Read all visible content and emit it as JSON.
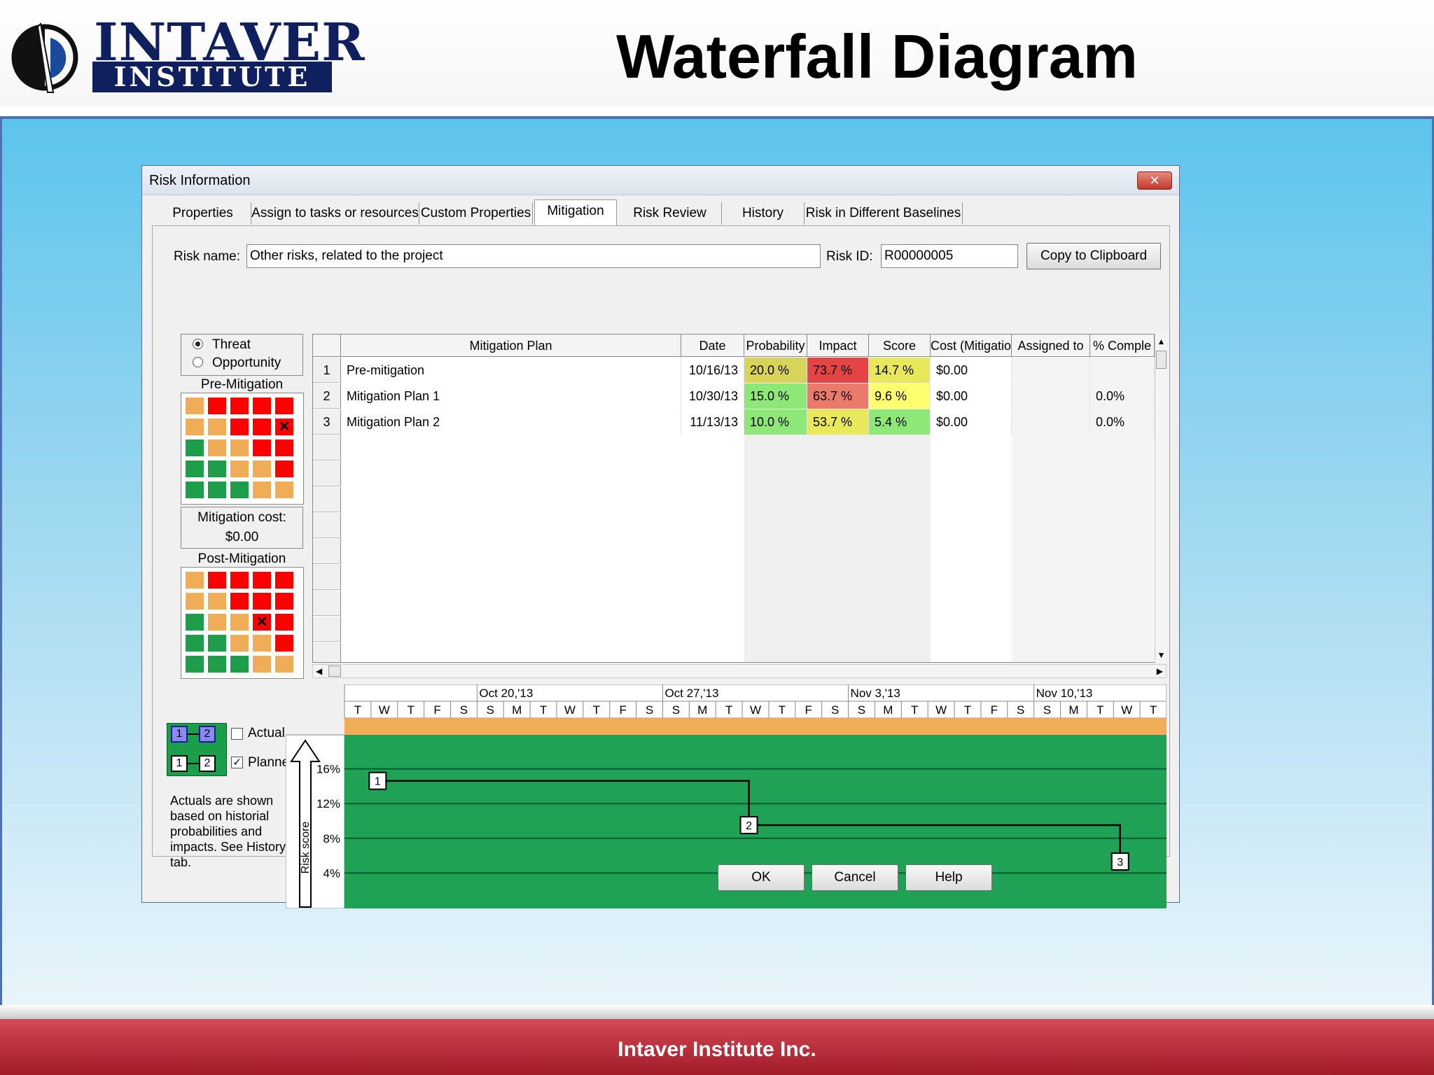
{
  "slide": {
    "logo_word1": "INTAVER",
    "logo_word2": "INSTITUTE",
    "title": "Waterfall Diagram",
    "footer": "Intaver Institute Inc."
  },
  "dialog": {
    "title": "Risk Information",
    "close_glyph": "✕",
    "tabs": [
      "Properties",
      "Assign to tasks or resources",
      "Custom Properties",
      "Mitigation",
      "Risk Review",
      "History",
      "Risk in Different Baselines"
    ],
    "active_tab": "Mitigation",
    "risk_name_label": "Risk name:",
    "risk_name_value": "Other risks, related to the project",
    "risk_id_label": "Risk ID:",
    "risk_id_value": "R00000005",
    "copy_button": "Copy to Clipboard",
    "threat_label": "Threat",
    "opportunity_label": "Opportunity",
    "pre_mitigation_label": "Pre-Mitigation",
    "post_mitigation_label": "Post-Mitigation",
    "mitigation_cost_label": "Mitigation cost:",
    "mitigation_cost_value": "$0.00",
    "ok_button": "OK",
    "cancel_button": "Cancel",
    "help_button": "Help"
  },
  "matrix": {
    "colors": {
      "orange": "#f0ac56",
      "red": "#ff0000",
      "green": "#1e9e4a"
    },
    "cells": [
      [
        "orange",
        "red",
        "red",
        "red",
        "red"
      ],
      [
        "orange",
        "orange",
        "red",
        "red",
        "red"
      ],
      [
        "green",
        "orange",
        "orange",
        "red",
        "red"
      ],
      [
        "green",
        "green",
        "orange",
        "orange",
        "red"
      ],
      [
        "green",
        "green",
        "green",
        "orange",
        "orange"
      ]
    ],
    "pre_mark": [
      1,
      4
    ],
    "post_mark": [
      2,
      3
    ],
    "mark_glyph": "✕"
  },
  "table": {
    "columns": [
      "Mitigation Plan",
      "Date",
      "Probability",
      "Impact",
      "Score",
      "Cost (Mitigatio",
      "Assigned to",
      "% Comple"
    ],
    "rows": [
      {
        "n": "1",
        "plan": "Pre-mitigation",
        "date": "10/16/13",
        "prob": "20.0 %",
        "impact": "73.7 %",
        "score": "14.7 %",
        "cost": "$0.00",
        "assigned": "",
        "pct": ""
      },
      {
        "n": "2",
        "plan": "Mitigation Plan 1",
        "date": "10/30/13",
        "prob": "15.0 %",
        "impact": "63.7 %",
        "score": "9.6 %",
        "cost": "$0.00",
        "assigned": "",
        "pct": "0.0%"
      },
      {
        "n": "3",
        "plan": "Mitigation Plan 2",
        "date": "11/13/13",
        "prob": "10.0 %",
        "impact": "53.7 %",
        "score": "5.4 %",
        "cost": "$0.00",
        "assigned": "",
        "pct": "0.0%"
      }
    ],
    "cell_colors": {
      "prob": [
        "#d8d45a",
        "#8ee878",
        "#8ee878"
      ],
      "impact": [
        "#e54444",
        "#ec7a6a",
        "#e8e85a"
      ],
      "score": [
        "#e8e85a",
        "#ffff70",
        "#8ee878"
      ]
    }
  },
  "legend": {
    "actual_label": "Actual",
    "planned_label": "Planned",
    "planned_checked": "✓",
    "box1": "1",
    "box2": "2",
    "note": "Actuals are shown based on historial probabilities and impacts. See History tab."
  },
  "chart_data": {
    "type": "line",
    "ylabel": "Risk score",
    "weeks": [
      "Oct 20,'13",
      "Oct 27,'13",
      "Nov 3,'13",
      "Nov 10,'13"
    ],
    "day_letters": [
      "T",
      "W",
      "T",
      "F",
      "S",
      "S",
      "M",
      "T",
      "W",
      "T",
      "F",
      "S",
      "S",
      "M",
      "T",
      "W",
      "T",
      "F",
      "S",
      "S",
      "M",
      "T",
      "W",
      "T",
      "F",
      "S",
      "S",
      "M",
      "T",
      "W",
      "T"
    ],
    "yticks": [
      "16%",
      "12%",
      "8%",
      "4%"
    ],
    "ylim": [
      0,
      20
    ],
    "series": [
      {
        "points": [
          {
            "label": "1",
            "date": "10/16/13",
            "score": 14.7
          },
          {
            "label": "2",
            "date": "10/30/13",
            "score": 9.6
          },
          {
            "label": "3",
            "date": "11/13/13",
            "score": 5.4
          }
        ]
      }
    ],
    "colors": {
      "band": "#f0ac56",
      "plot": "#1fa256",
      "line": "#000000"
    }
  }
}
